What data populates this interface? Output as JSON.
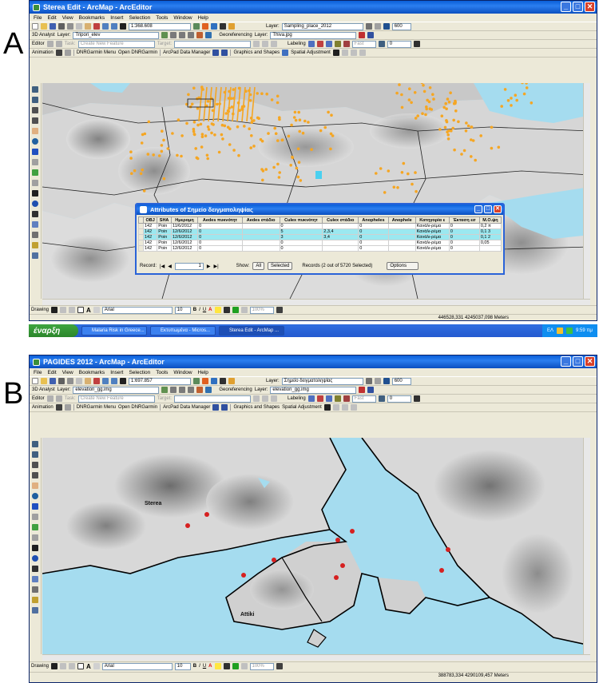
{
  "panels": {
    "a": {
      "letter": "A",
      "title": "Sterea Edit - ArcMap - ArcEditor",
      "menu": [
        "File",
        "Edit",
        "View",
        "Bookmarks",
        "Insert",
        "Selection",
        "Tools",
        "Window",
        "Help"
      ],
      "scale": "1:368.608",
      "layer_label": "Layer:",
      "layer_value": "Sampling_place_2012",
      "zoom_value": "600",
      "analyst_label": "3D Analyst",
      "analyst_layer": "Tripori_elev",
      "georef_label": "Georeferencing",
      "georef_layer": "Thiva.jpg",
      "editor_label": "Editor",
      "task_label": "Task:",
      "task_value": "Create New Feature",
      "target_label": "Target:",
      "labeling_label": "Labeling",
      "fast_value": "Fast",
      "spin_value": "0",
      "animation_label": "Animation",
      "dnr_label": "DNRGarmin Menu",
      "dnr_open": "Open DNRGarmin",
      "arcpad_label": "ArcPad Data Manager",
      "graphics_label": "Graphics and Shapes",
      "spatial_label": "Spatial Adjustment",
      "drawing_label": "Drawing",
      "font_value": "Arial",
      "font_size": "10",
      "zoom_percent": "100%",
      "coords": "446528,331  4245037,098 Meters",
      "taskbar": {
        "start": "έναρξη",
        "tasks": [
          "Malaria Risk in Greece...",
          "Εκτυπωμένα - Micros...",
          "Sterea Edit - ArcMap ..."
        ],
        "lang": "ΕΛ",
        "time": "9:59 πμ"
      },
      "attributes": {
        "title": "Attributes of Σημείο δειγματοληψίας",
        "columns": [
          "OBJ",
          "SHA",
          "Ημερομη",
          "Aedes πυκνότητ",
          "Aedes στάδιο",
          "Culex πυκνότητ",
          "Culex στάδιο",
          "Anopheles",
          "Anophele",
          "Κατηγορία ε",
          "Έκταση εσ",
          "Μ.Ο.ψη"
        ],
        "rows": [
          {
            "sel": false,
            "cells": [
              "142",
              "Poin",
              "11/6/2012",
              "0",
              "",
              "0",
              "",
              "0",
              "",
              "Κανάλι-ρέμα",
              "0",
              "0,2 π"
            ]
          },
          {
            "sel": true,
            "cells": [
              "142",
              "Poin",
              "12/6/2012",
              "0",
              "",
              "5",
              "2,3,4",
              "0",
              "",
              "Κανάλι-ρέμα",
              "0",
              "0,1 3"
            ]
          },
          {
            "sel": true,
            "cells": [
              "142",
              "Poin",
              "12/6/2012",
              "0",
              "",
              "3",
              "3,4",
              "0",
              "",
              "Κανάλι-ρέμα",
              "0",
              "0,1 2"
            ]
          },
          {
            "sel": false,
            "cells": [
              "142",
              "Poin",
              "12/6/2012",
              "0",
              "",
              "0",
              "",
              "0",
              "",
              "Κανάλι-ρέμα",
              "0",
              "0,05"
            ]
          },
          {
            "sel": false,
            "cells": [
              "142",
              "Poin",
              "12/6/2012",
              "0",
              "",
              "0",
              "",
              "0",
              "",
              "Κανάλι-ρέμα",
              "0",
              ""
            ]
          }
        ],
        "record_label": "Record:",
        "record_value": "1",
        "show_label": "Show:",
        "show_all": "All",
        "show_selected": "Selected",
        "records_text": "Records (2 out of 5720 Selected)",
        "options_label": "Options"
      }
    },
    "b": {
      "letter": "B",
      "title": "PAGIDES 2012 - ArcMap - ArcEditor",
      "menu": [
        "File",
        "Edit",
        "View",
        "Bookmarks",
        "Insert",
        "Selection",
        "Tools",
        "Window",
        "Help"
      ],
      "scale": "1:697.857",
      "layer_label": "Layer:",
      "layer_value": "Σημείο δειγματοληψίας",
      "zoom_value": "600",
      "analyst_label": "3D Analyst",
      "analyst_layer": "elevation_gg.img",
      "georef_label": "Georeferencing",
      "georef_layer": "elevation_gg.img",
      "editor_label": "Editor",
      "task_label": "Task:",
      "task_value": "Create New Feature",
      "target_label": "Target:",
      "labeling_label": "Labeling",
      "fast_value": "Fast",
      "spin_value": "0",
      "animation_label": "Animation",
      "dnr_label": "DNRGarmin Menu",
      "dnr_open": "Open DNRGarmin",
      "arcpad_label": "ArcPad Data Manager",
      "graphics_label": "Graphics and Shapes",
      "spatial_label": "Spatial Adjustment",
      "drawing_label": "Drawing",
      "font_value": "Arial",
      "font_size": "10",
      "zoom_percent": "100%",
      "coords": "388783,334  4290109,457 Meters",
      "map_labels": {
        "sterea": "Sterea",
        "attiki": "Attiki"
      }
    }
  },
  "colors": {
    "title_blue": "#0a5fd8",
    "point_orange": "#f5a623",
    "point_red": "#d62020",
    "water": "#a5dcef"
  }
}
